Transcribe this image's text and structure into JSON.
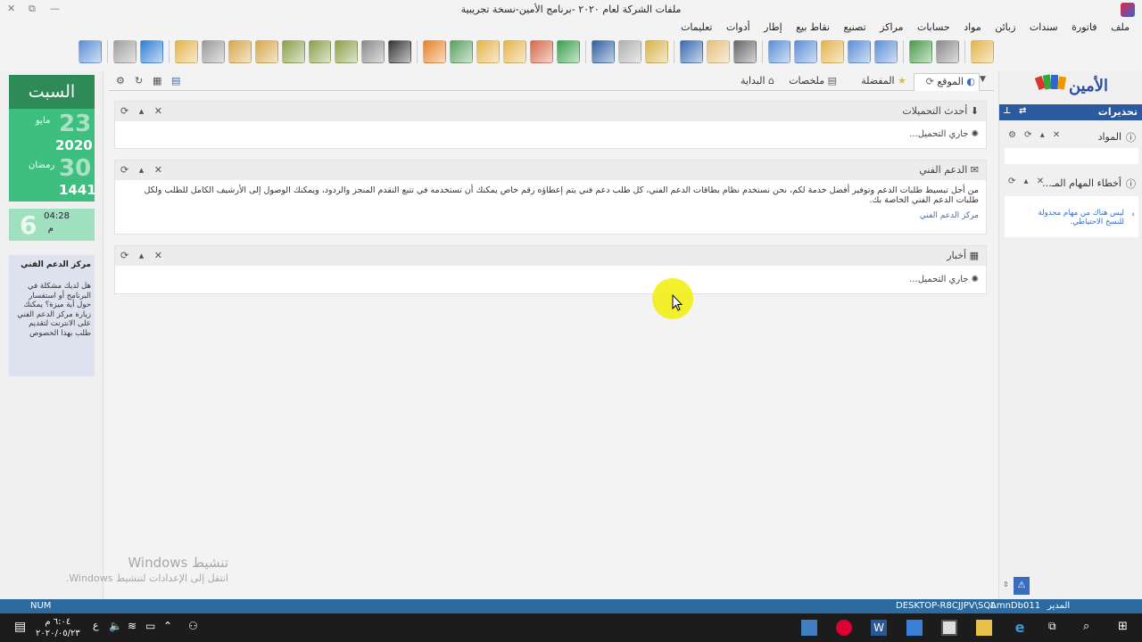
{
  "window": {
    "title": "ملفات الشركة لعام ٢٠٢٠ -برنامج الأمين-نسخة تجريبية",
    "controls": [
      "✕",
      "⧉",
      "—"
    ]
  },
  "menu": {
    "items": [
      "ملف",
      "فاتورة",
      "سندات",
      "زبائن",
      "مواد",
      "حسابات",
      "مراكز",
      "تصنيع",
      "نقاط بيع",
      "إطار",
      "أدوات",
      "تعليمات"
    ]
  },
  "toolbar": {
    "buttons": [
      {
        "name": "user-icon",
        "color": "#5b8fd6"
      },
      {
        "name": "calculator-icon",
        "color": "#a0a0a0"
      },
      {
        "name": "refresh-icon",
        "color": "#2f7fd6"
      },
      {
        "name": "folder-icon",
        "color": "#e5b44a"
      },
      {
        "name": "gear-icon",
        "color": "#9a9a9a"
      },
      {
        "name": "users-icon",
        "color": "#d6a74a"
      },
      {
        "name": "users-group-icon",
        "color": "#d6a74a"
      },
      {
        "name": "arrow-left-icon",
        "color": "#8aa04a"
      },
      {
        "name": "arrow-right-icon",
        "color": "#8aa04a"
      },
      {
        "name": "download-icon",
        "color": "#8aa04a"
      },
      {
        "name": "transfer-icon",
        "color": "#8a8a8a"
      },
      {
        "name": "barcode-icon",
        "color": "#333333"
      },
      {
        "name": "pie-icon",
        "color": "#e8822a"
      },
      {
        "name": "chart-icon",
        "color": "#5aa060"
      },
      {
        "name": "report-icon",
        "color": "#e5b44a"
      },
      {
        "name": "report-edit-icon",
        "color": "#e5b44a"
      },
      {
        "name": "database-icon",
        "color": "#d66a4a"
      },
      {
        "name": "book-icon",
        "color": "#3aa04a"
      },
      {
        "name": "info-icon",
        "color": "#2f5fa0"
      },
      {
        "name": "print-icon",
        "color": "#b0b0b0"
      },
      {
        "name": "scale-icon",
        "color": "#d6b44a"
      },
      {
        "name": "notebook-icon",
        "color": "#3a6ab0"
      },
      {
        "name": "document-icon",
        "color": "#e5c07a"
      },
      {
        "name": "pen-icon",
        "color": "#666666"
      },
      {
        "name": "window-icon",
        "color": "#5b8fd6"
      },
      {
        "name": "window-chart-icon",
        "color": "#5b8fd6"
      },
      {
        "name": "window-folder-icon",
        "color": "#e5b44a"
      },
      {
        "name": "window-user-icon",
        "color": "#5b8fd6"
      },
      {
        "name": "window-graph-icon",
        "color": "#5b8fd6"
      },
      {
        "name": "money-icon",
        "color": "#4a9a4a"
      },
      {
        "name": "settings-doc-icon",
        "color": "#8a8a8a"
      },
      {
        "name": "open-folder-icon",
        "color": "#e5b44a"
      }
    ]
  },
  "left_panel": {
    "day": "السبت",
    "gregorian": {
      "day": "23",
      "month": "مايو",
      "year": "2020"
    },
    "hijri": {
      "day": "30",
      "month": "رمضان",
      "year": "1441"
    },
    "time": {
      "day_num": "6",
      "time": "04:28",
      "ampm": "م"
    },
    "support": {
      "heading": "مركز الدعم الفني",
      "body": "هل لديك مشكلة في البرنامج أو استفسار حول أية ميزة؟ يمكنك زيارة مركز الدعم الفني على الانترنت لتقديم طلب بهذا الخصوص"
    }
  },
  "tabs": {
    "items": [
      {
        "label": "الموقع",
        "active": true
      },
      {
        "label": "المفضلة",
        "active": false
      },
      {
        "label": "ملخصات",
        "active": false
      },
      {
        "label": "البداية",
        "active": false
      }
    ],
    "controls": [
      "⚙",
      "↻",
      "▦",
      "▤"
    ]
  },
  "widgets": {
    "downloads": {
      "title": "أحدث التحميلات",
      "loading": "جاري التحميل..."
    },
    "support": {
      "title": "الدعم الفني",
      "body": "من أجل تبسيط طلبات الدعم وتوفير أفضل خدمة لكم، نحن نستخدم نظام بطاقات الدعم الفني، كل طلب دعم فني يتم إعطاؤه رقم خاص يمكنك أن تستخدمه في تتبع التقدم المنجز والردود، ويمكنك الوصول إلى الأرشيف الكامل للطلب ولكل طلبات الدعم الفني الخاصة بك.",
      "link": "مركز الدعم الفني"
    },
    "news": {
      "title": "أخبار",
      "loading": "جاري التحميل..."
    },
    "controls": "✕ ▴ ⟳"
  },
  "right_panel": {
    "logo_text": "الأمين",
    "header": "تحذيرات",
    "items": [
      {
        "label": "المواد",
        "controls": "✕ ▴ ⟳ ⚙"
      },
      {
        "label": "أخطاء المهام المـ...",
        "controls": "✕ ▴ ⟳"
      }
    ],
    "task_message": "ليس هناك من مهام مجدولة للنسخ الاحتياطي."
  },
  "statusbar": {
    "num": "NUM",
    "server": "DESKTOP-R8CJJPV\\SQL",
    "database": "AmnDb011",
    "user": "المدير"
  },
  "taskbar": {
    "time": "٦:٠٤ م",
    "date": "٢٠٢٠/٠٥/٢٣",
    "lang": "ع"
  },
  "watermark": {
    "line1": "تنشيط Windows",
    "line2": "انتقل إلى الإعدادات لتنشيط Windows."
  }
}
